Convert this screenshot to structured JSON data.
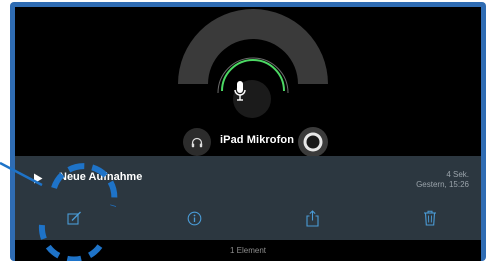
{
  "recorder": {
    "microphone_label": "iPad Mikrofon",
    "icons": [
      "microphone-icon",
      "headphones-icon",
      "input-level-icon"
    ]
  },
  "recording": {
    "title": "Neue Aufnahme",
    "duration": "4 Sek.",
    "date": "Gestern, 15:26"
  },
  "toolbar": {
    "icons": [
      "edit-icon",
      "info-icon",
      "share-icon",
      "trash-icon"
    ]
  },
  "footer": {
    "count": "1 Element"
  },
  "colors": {
    "bezel": "#2f6cb3",
    "accent": "#4a9bd6",
    "level_green": "#4cd964",
    "row_background": "#2c3740",
    "annotation": "#1e73c8"
  }
}
